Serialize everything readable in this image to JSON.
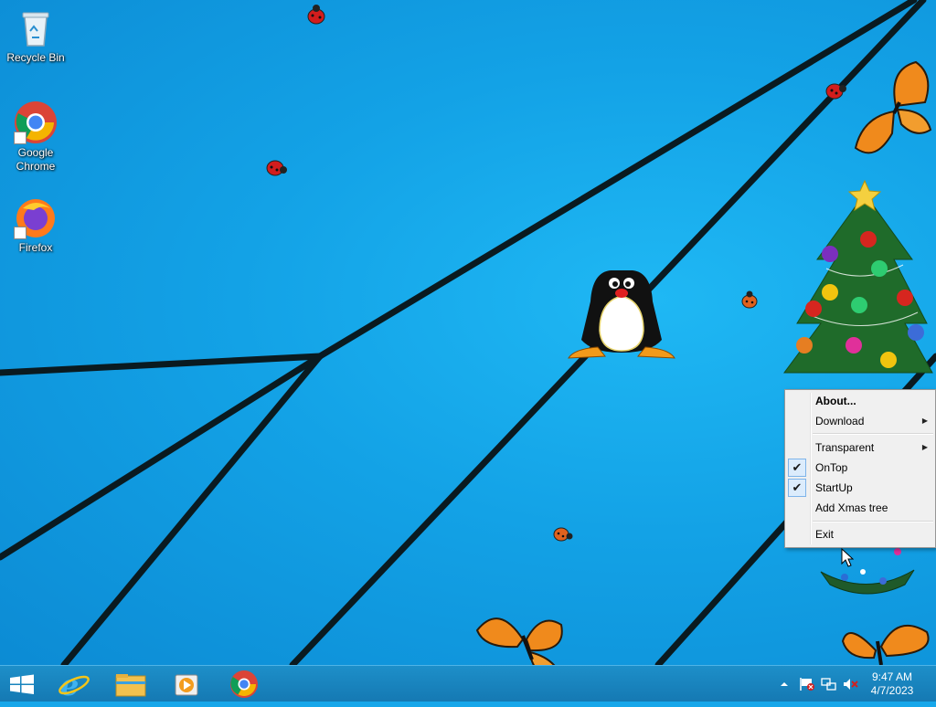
{
  "desktop": {
    "icons": [
      {
        "label": "Recycle Bin",
        "icon": "recycle-bin-icon"
      },
      {
        "label": "Google Chrome",
        "icon": "chrome-icon"
      },
      {
        "label": "Firefox",
        "icon": "firefox-icon"
      }
    ]
  },
  "context_menu": {
    "items": [
      {
        "label": "About...",
        "bold": true
      },
      {
        "label": "Download",
        "submenu": true
      },
      {
        "label": "Transparent",
        "submenu": true
      },
      {
        "label": "OnTop",
        "checked": true
      },
      {
        "label": "StartUp",
        "checked": true
      },
      {
        "label": "Add Xmas tree"
      },
      {
        "label": "Exit"
      }
    ],
    "check_glyph": "✔",
    "arrow_glyph": "▶"
  },
  "taskbar": {
    "pinned": [
      "start-button",
      "internet-explorer",
      "file-explorer",
      "media-player",
      "google-chrome"
    ],
    "tray_icons": [
      "show-hidden-icons",
      "action-center-flag",
      "network",
      "volume-muted"
    ],
    "clock": {
      "time": "9:47 AM",
      "date": "4/7/2023"
    }
  },
  "colors": {
    "desktop": "#13a2e6",
    "taskbar": "#1a86c0",
    "menu_bg": "#f0f0f0",
    "menu_check_bg": "#dcecfc"
  }
}
